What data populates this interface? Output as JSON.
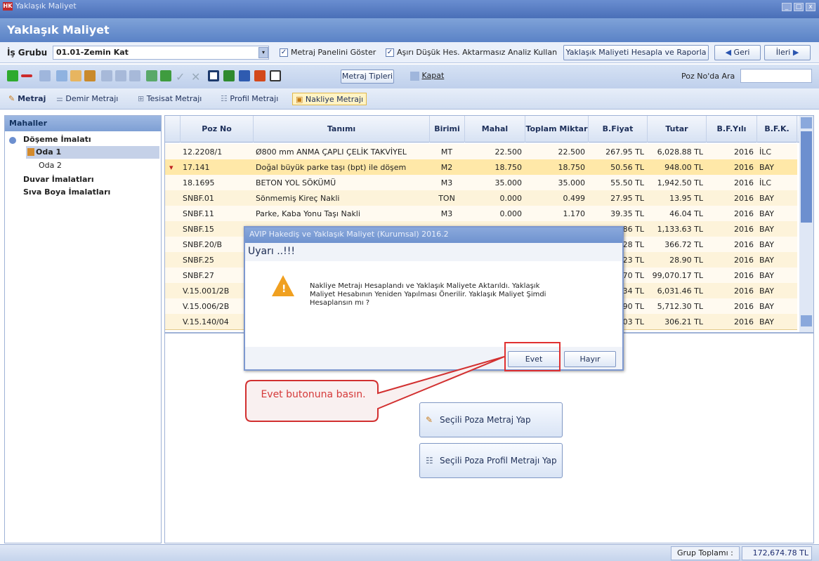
{
  "window": {
    "title": "Yaklaşık Maliyet",
    "header": "Yaklaşık Maliyet"
  },
  "toolbar1": {
    "group_label": "İş Grubu",
    "group_value": "01.01-Zemin Kat",
    "chk_metraj": "Metraj Panelini Göster",
    "chk_asiri": "Aşırı Düşük Hes. Aktarmasız Analiz Kullan",
    "calc_btn": "Yaklaşık Maliyeti Hesapla ve Raporla",
    "back_btn": "Geri",
    "next_btn": "İleri"
  },
  "toolbar2": {
    "metraj_types": "Metraj Tipleri",
    "close": "Kapat",
    "search_label": "Poz No'da Ara",
    "search_value": ""
  },
  "tabs": [
    "Metraj",
    "Demir Metrajı",
    "Tesisat Metrajı",
    "Profil Metrajı",
    "Nakliye Metrajı"
  ],
  "left": {
    "title": "Mahaller",
    "items": [
      "Döşeme İmalatı",
      "Oda 1",
      "Oda 2",
      "Duvar İmalatları",
      "Sıva Boya İmalatları"
    ]
  },
  "grid": {
    "columns": [
      "Poz No",
      "Tanımı",
      "Birimi",
      "Mahal Miktarı",
      "Toplam Miktar",
      "B.Fiyat",
      "Tutar",
      "B.F.Yılı",
      "B.F.K."
    ],
    "rows": [
      [
        "12.2208/1",
        "Ø800 mm ANMA ÇAPLI ÇELİK TAKVİYEL",
        "MT",
        "22.500",
        "22.500",
        "267.95 TL",
        "6,028.88 TL",
        "2016",
        "İLC"
      ],
      [
        "17.141",
        "Doğal büyük parke taşı (bpt) ile döşem",
        "M2",
        "18.750",
        "18.750",
        "50.56 TL",
        "948.00 TL",
        "2016",
        "BAY"
      ],
      [
        "18.1695",
        "BETON YOL SÖKÜMÜ",
        "M3",
        "35.000",
        "35.000",
        "55.50 TL",
        "1,942.50 TL",
        "2016",
        "İLC"
      ],
      [
        "SNBF.01",
        "Sönmemiş Kireç Nakli",
        "TON",
        "0.000",
        "0.499",
        "27.95 TL",
        "13.95 TL",
        "2016",
        "BAY"
      ],
      [
        "SNBF.11",
        "Parke, Kaba Yonu Taşı Nakli",
        "M3",
        "0.000",
        "1.170",
        "39.35 TL",
        "46.04 TL",
        "2016",
        "BAY"
      ],
      [
        "SNBF.15",
        "",
        "",
        "",
        "",
        "6.86 TL",
        "1,133.63 TL",
        "2016",
        "BAY"
      ],
      [
        "SNBF.20/B",
        "",
        "",
        "",
        "",
        "5.28 TL",
        "366.72 TL",
        "2016",
        "BAY"
      ],
      [
        "SNBF.25",
        "",
        "",
        "",
        "",
        "0.23 TL",
        "28.90 TL",
        "2016",
        "BAY"
      ],
      [
        "SNBF.27",
        "",
        "",
        "",
        "",
        "8.70 TL",
        "99,070.17 TL",
        "2016",
        "BAY"
      ],
      [
        "V.15.001/2B",
        "",
        "",
        "",
        "",
        "3.34 TL",
        "6,031.46 TL",
        "2016",
        "BAY"
      ],
      [
        "V.15.006/2B",
        "",
        "",
        "",
        "",
        "4.90 TL",
        "5,712.30 TL",
        "2016",
        "BAY"
      ],
      [
        "V.15.140/04",
        "",
        "",
        "",
        "",
        "3.03 TL",
        "306.21 TL",
        "2016",
        "BAY"
      ]
    ]
  },
  "buttons": {
    "metraj": "Seçili Poza Metraj Yap",
    "profil": "Seçili Poza Profil Metrajı Yap"
  },
  "dialog": {
    "caption": "AVIP Hakediş ve Yaklaşık Maliyet (Kurumsal) 2016.2",
    "title": "Uyarı ..!!!",
    "message": "Nakliye Metrajı Hesaplandı ve Yaklaşık Maliyete Aktarıldı. Yaklaşık Maliyet Hesabının Yeniden Yapılması Önerilir. Yaklaşık Maliyet Şimdi Hesaplansın mı ?",
    "yes": "Evet",
    "no": "Hayır"
  },
  "callout": "Evet butonuna basın.",
  "status": {
    "label": "Grup Toplamı :",
    "value": "172,674.78 TL"
  }
}
